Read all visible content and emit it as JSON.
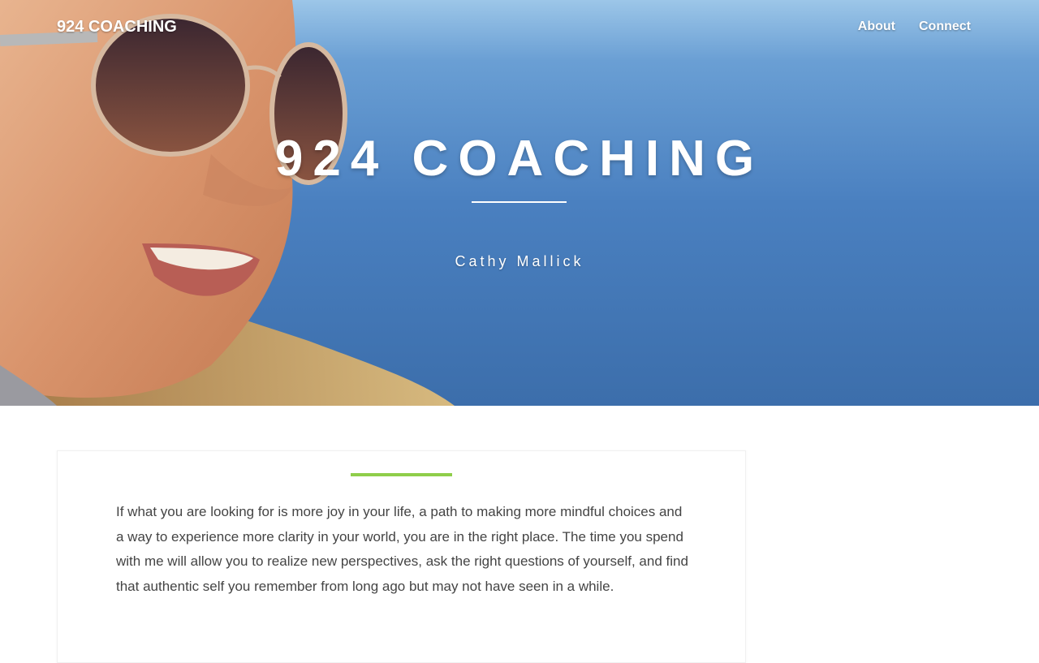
{
  "header": {
    "logo": "924 COACHING",
    "nav": [
      {
        "label": "About"
      },
      {
        "label": "Connect"
      }
    ]
  },
  "hero": {
    "title": "924 COACHING",
    "subtitle": "Cathy Mallick"
  },
  "main": {
    "intro": "If what you are looking for is more joy in your life, a path to making more mindful choices and a way to experience more clarity in your world, you are in the right place. The time you spend with me will allow you to realize new perspectives, ask the right questions of yourself, and find that authentic self you remember from long ago but may not have seen in a while."
  },
  "colors": {
    "accent": "#8fce4a",
    "sky": "#8fbde3",
    "sea": "#3f74b4",
    "text": "#444444"
  }
}
